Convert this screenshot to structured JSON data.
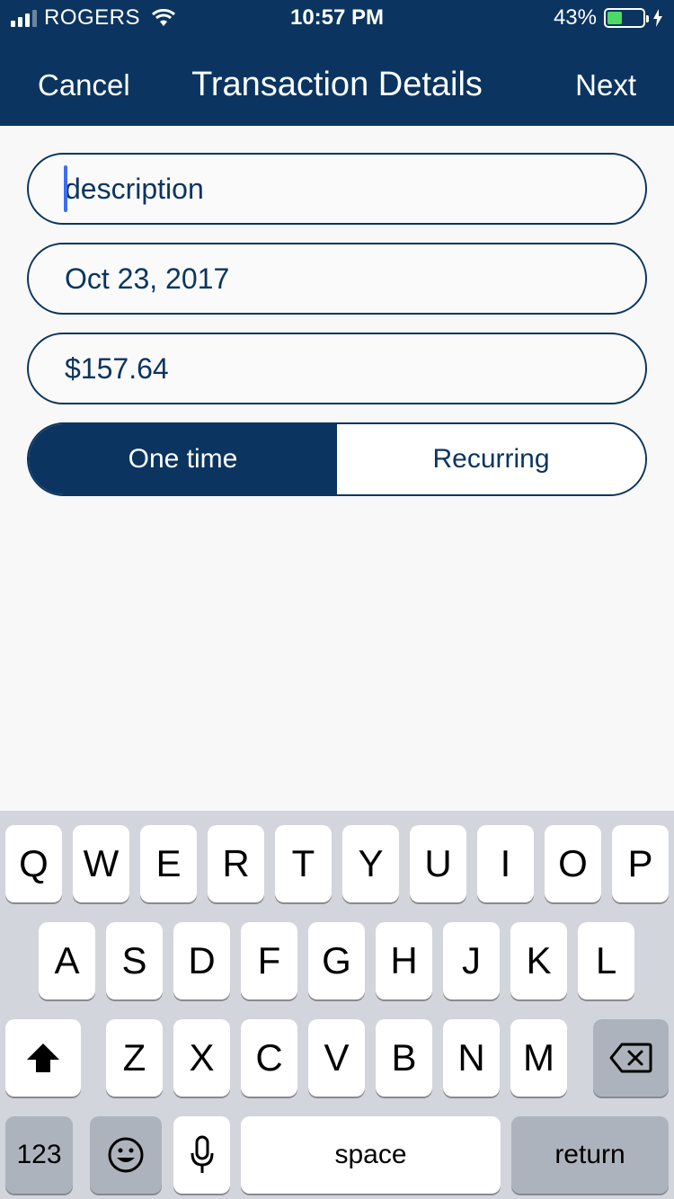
{
  "status_bar": {
    "carrier": "ROGERS",
    "time": "10:57 PM",
    "battery_percent": "43%",
    "battery_level": 0.43,
    "signal_bars_filled": 3,
    "signal_bars_total": 4,
    "icons": [
      "signal-icon",
      "wifi-icon",
      "battery-icon",
      "charging-bolt-icon"
    ]
  },
  "nav": {
    "cancel_label": "Cancel",
    "title": "Transaction Details",
    "next_label": "Next"
  },
  "form": {
    "description": {
      "placeholder": "description",
      "value": ""
    },
    "date": {
      "value": "Oct 23, 2017"
    },
    "amount": {
      "value": "$157.64"
    },
    "frequency": {
      "options": [
        "One time",
        "Recurring"
      ],
      "selected": "One time"
    }
  },
  "keyboard": {
    "row1": [
      "Q",
      "W",
      "E",
      "R",
      "T",
      "Y",
      "U",
      "I",
      "O",
      "P"
    ],
    "row2": [
      "A",
      "S",
      "D",
      "F",
      "G",
      "H",
      "J",
      "K",
      "L"
    ],
    "row3": [
      "Z",
      "X",
      "C",
      "V",
      "B",
      "N",
      "M"
    ],
    "numbers_label": "123",
    "space_label": "space",
    "return_label": "return",
    "icons": [
      "shift-icon",
      "backspace-icon",
      "emoji-icon",
      "microphone-icon"
    ]
  },
  "colors": {
    "brand_navy": "#0b3560",
    "caret_blue": "#3b6ef5",
    "battery_green": "#4cd964",
    "keyboard_bg": "#d2d5db",
    "key_dark": "#adb3bc"
  }
}
